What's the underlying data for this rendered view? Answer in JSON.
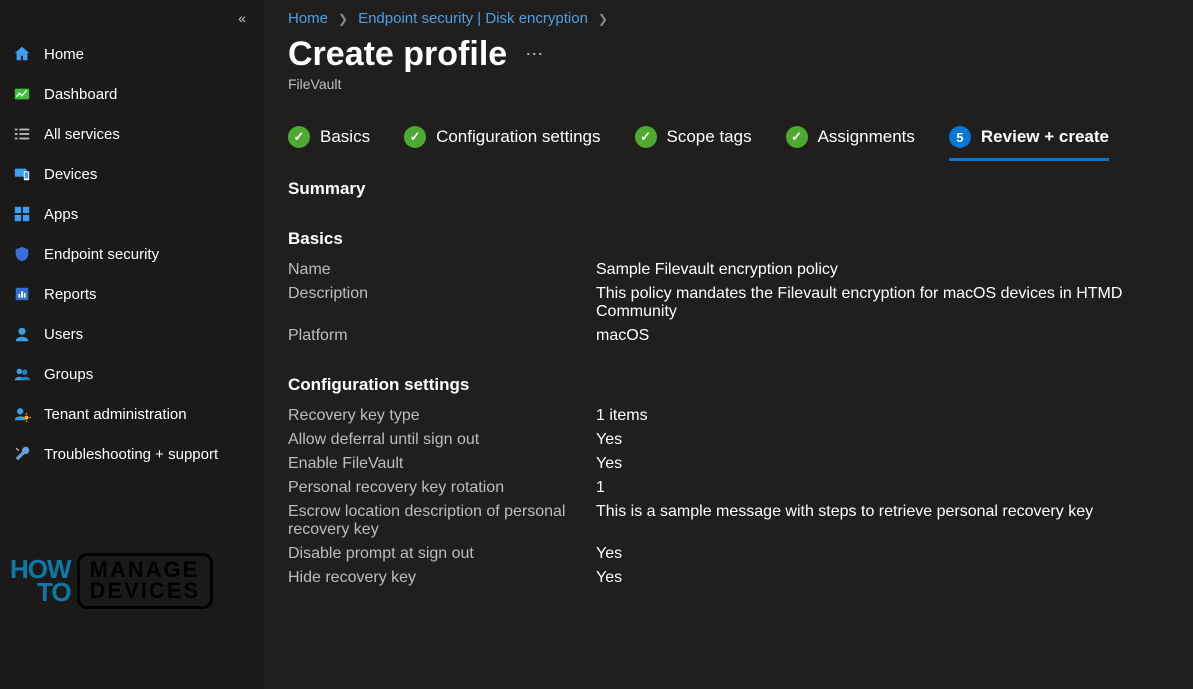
{
  "sidebar": {
    "items": [
      {
        "label": "Home",
        "icon": "home-icon"
      },
      {
        "label": "Dashboard",
        "icon": "dashboard-icon"
      },
      {
        "label": "All services",
        "icon": "list-icon"
      },
      {
        "label": "Devices",
        "icon": "devices-icon"
      },
      {
        "label": "Apps",
        "icon": "apps-icon"
      },
      {
        "label": "Endpoint security",
        "icon": "shield-icon"
      },
      {
        "label": "Reports",
        "icon": "reports-icon"
      },
      {
        "label": "Users",
        "icon": "user-icon"
      },
      {
        "label": "Groups",
        "icon": "groups-icon"
      },
      {
        "label": "Tenant administration",
        "icon": "tenant-icon"
      },
      {
        "label": "Troubleshooting + support",
        "icon": "wrench-icon"
      }
    ]
  },
  "breadcrumb": {
    "items": [
      "Home",
      "Endpoint security | Disk encryption"
    ]
  },
  "header": {
    "title": "Create profile",
    "subtitle": "FileVault"
  },
  "stepper": {
    "steps": [
      {
        "label": "Basics",
        "state": "done"
      },
      {
        "label": "Configuration settings",
        "state": "done"
      },
      {
        "label": "Scope tags",
        "state": "done"
      },
      {
        "label": "Assignments",
        "state": "done"
      },
      {
        "label": "Review + create",
        "state": "active",
        "num": "5"
      }
    ]
  },
  "summary": {
    "heading": "Summary",
    "basics": {
      "title": "Basics",
      "rows": [
        {
          "k": "Name",
          "v": "Sample Filevault encryption policy"
        },
        {
          "k": "Description",
          "v": "This policy mandates the Filevault encryption for macOS devices in HTMD Community"
        },
        {
          "k": "Platform",
          "v": "macOS"
        }
      ]
    },
    "config": {
      "title": "Configuration settings",
      "rows": [
        {
          "k": "Recovery key type",
          "v": "1 items"
        },
        {
          "k": "Allow deferral until sign out",
          "v": "Yes"
        },
        {
          "k": "Enable FileVault",
          "v": "Yes"
        },
        {
          "k": "Personal recovery key rotation",
          "v": "1"
        },
        {
          "k": "Escrow location description of personal recovery key",
          "v": "This is a sample message with steps to retrieve personal recovery key"
        },
        {
          "k": "Disable prompt at sign out",
          "v": "Yes"
        },
        {
          "k": "Hide recovery key",
          "v": "Yes"
        }
      ]
    }
  },
  "watermark": {
    "left1": "HOW",
    "left2": "TO",
    "right1": "MANAGE",
    "right2": "DEVICES"
  }
}
